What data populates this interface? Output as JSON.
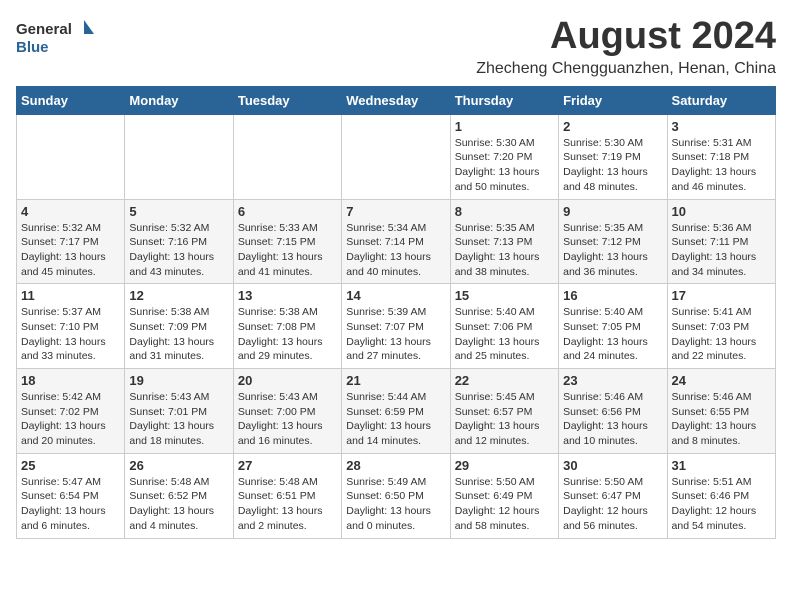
{
  "logo": {
    "general": "General",
    "blue": "Blue"
  },
  "title": "August 2024",
  "subtitle": "Zhecheng Chengguanzhen, Henan, China",
  "weekdays": [
    "Sunday",
    "Monday",
    "Tuesday",
    "Wednesday",
    "Thursday",
    "Friday",
    "Saturday"
  ],
  "weeks": [
    [
      {
        "day": "",
        "info": ""
      },
      {
        "day": "",
        "info": ""
      },
      {
        "day": "",
        "info": ""
      },
      {
        "day": "",
        "info": ""
      },
      {
        "day": "1",
        "info": "Sunrise: 5:30 AM\nSunset: 7:20 PM\nDaylight: 13 hours\nand 50 minutes."
      },
      {
        "day": "2",
        "info": "Sunrise: 5:30 AM\nSunset: 7:19 PM\nDaylight: 13 hours\nand 48 minutes."
      },
      {
        "day": "3",
        "info": "Sunrise: 5:31 AM\nSunset: 7:18 PM\nDaylight: 13 hours\nand 46 minutes."
      }
    ],
    [
      {
        "day": "4",
        "info": "Sunrise: 5:32 AM\nSunset: 7:17 PM\nDaylight: 13 hours\nand 45 minutes."
      },
      {
        "day": "5",
        "info": "Sunrise: 5:32 AM\nSunset: 7:16 PM\nDaylight: 13 hours\nand 43 minutes."
      },
      {
        "day": "6",
        "info": "Sunrise: 5:33 AM\nSunset: 7:15 PM\nDaylight: 13 hours\nand 41 minutes."
      },
      {
        "day": "7",
        "info": "Sunrise: 5:34 AM\nSunset: 7:14 PM\nDaylight: 13 hours\nand 40 minutes."
      },
      {
        "day": "8",
        "info": "Sunrise: 5:35 AM\nSunset: 7:13 PM\nDaylight: 13 hours\nand 38 minutes."
      },
      {
        "day": "9",
        "info": "Sunrise: 5:35 AM\nSunset: 7:12 PM\nDaylight: 13 hours\nand 36 minutes."
      },
      {
        "day": "10",
        "info": "Sunrise: 5:36 AM\nSunset: 7:11 PM\nDaylight: 13 hours\nand 34 minutes."
      }
    ],
    [
      {
        "day": "11",
        "info": "Sunrise: 5:37 AM\nSunset: 7:10 PM\nDaylight: 13 hours\nand 33 minutes."
      },
      {
        "day": "12",
        "info": "Sunrise: 5:38 AM\nSunset: 7:09 PM\nDaylight: 13 hours\nand 31 minutes."
      },
      {
        "day": "13",
        "info": "Sunrise: 5:38 AM\nSunset: 7:08 PM\nDaylight: 13 hours\nand 29 minutes."
      },
      {
        "day": "14",
        "info": "Sunrise: 5:39 AM\nSunset: 7:07 PM\nDaylight: 13 hours\nand 27 minutes."
      },
      {
        "day": "15",
        "info": "Sunrise: 5:40 AM\nSunset: 7:06 PM\nDaylight: 13 hours\nand 25 minutes."
      },
      {
        "day": "16",
        "info": "Sunrise: 5:40 AM\nSunset: 7:05 PM\nDaylight: 13 hours\nand 24 minutes."
      },
      {
        "day": "17",
        "info": "Sunrise: 5:41 AM\nSunset: 7:03 PM\nDaylight: 13 hours\nand 22 minutes."
      }
    ],
    [
      {
        "day": "18",
        "info": "Sunrise: 5:42 AM\nSunset: 7:02 PM\nDaylight: 13 hours\nand 20 minutes."
      },
      {
        "day": "19",
        "info": "Sunrise: 5:43 AM\nSunset: 7:01 PM\nDaylight: 13 hours\nand 18 minutes."
      },
      {
        "day": "20",
        "info": "Sunrise: 5:43 AM\nSunset: 7:00 PM\nDaylight: 13 hours\nand 16 minutes."
      },
      {
        "day": "21",
        "info": "Sunrise: 5:44 AM\nSunset: 6:59 PM\nDaylight: 13 hours\nand 14 minutes."
      },
      {
        "day": "22",
        "info": "Sunrise: 5:45 AM\nSunset: 6:57 PM\nDaylight: 13 hours\nand 12 minutes."
      },
      {
        "day": "23",
        "info": "Sunrise: 5:46 AM\nSunset: 6:56 PM\nDaylight: 13 hours\nand 10 minutes."
      },
      {
        "day": "24",
        "info": "Sunrise: 5:46 AM\nSunset: 6:55 PM\nDaylight: 13 hours\nand 8 minutes."
      }
    ],
    [
      {
        "day": "25",
        "info": "Sunrise: 5:47 AM\nSunset: 6:54 PM\nDaylight: 13 hours\nand 6 minutes."
      },
      {
        "day": "26",
        "info": "Sunrise: 5:48 AM\nSunset: 6:52 PM\nDaylight: 13 hours\nand 4 minutes."
      },
      {
        "day": "27",
        "info": "Sunrise: 5:48 AM\nSunset: 6:51 PM\nDaylight: 13 hours\nand 2 minutes."
      },
      {
        "day": "28",
        "info": "Sunrise: 5:49 AM\nSunset: 6:50 PM\nDaylight: 13 hours\nand 0 minutes."
      },
      {
        "day": "29",
        "info": "Sunrise: 5:50 AM\nSunset: 6:49 PM\nDaylight: 12 hours\nand 58 minutes."
      },
      {
        "day": "30",
        "info": "Sunrise: 5:50 AM\nSunset: 6:47 PM\nDaylight: 12 hours\nand 56 minutes."
      },
      {
        "day": "31",
        "info": "Sunrise: 5:51 AM\nSunset: 6:46 PM\nDaylight: 12 hours\nand 54 minutes."
      }
    ]
  ]
}
